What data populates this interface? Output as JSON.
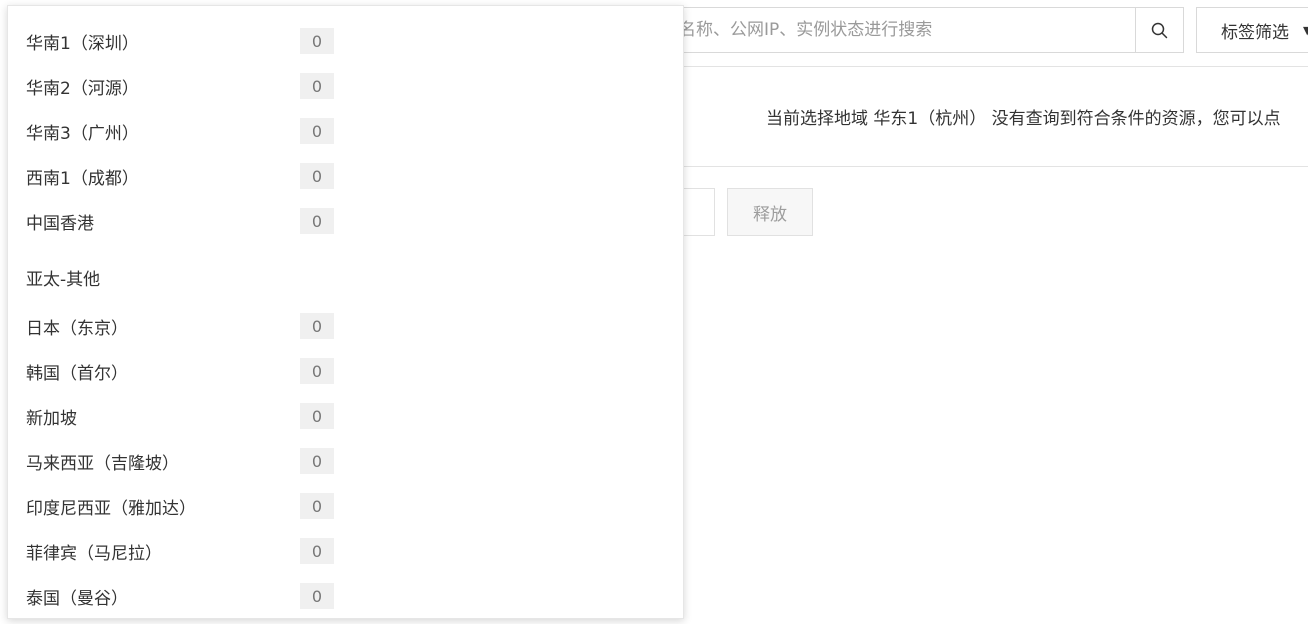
{
  "search": {
    "placeholder": "名称、公网IP、实例状态进行搜索"
  },
  "tag_filter": {
    "label": "标签筛选"
  },
  "empty_message": "当前选择地域 华东1（杭州） 没有查询到符合条件的资源，您可以点",
  "actions": {
    "release_label": "释放"
  },
  "region_dropdown": {
    "rows": [
      {
        "name": "华南1（深圳）",
        "count": "0"
      },
      {
        "name": "华南2（河源）",
        "count": "0"
      },
      {
        "name": "华南3（广州）",
        "count": "0"
      },
      {
        "name": "西南1（成都）",
        "count": "0"
      },
      {
        "name": "中国香港",
        "count": "0"
      }
    ],
    "group_title": "亚太-其他",
    "group_rows": [
      {
        "name": "日本（东京）",
        "count": "0"
      },
      {
        "name": "韩国（首尔）",
        "count": "0"
      },
      {
        "name": "新加坡",
        "count": "0"
      },
      {
        "name": "马来西亚（吉隆坡）",
        "count": "0"
      },
      {
        "name": "印度尼西亚（雅加达）",
        "count": "0"
      },
      {
        "name": "菲律宾（马尼拉）",
        "count": "0"
      },
      {
        "name": "泰国（曼谷）",
        "count": "0"
      }
    ]
  }
}
